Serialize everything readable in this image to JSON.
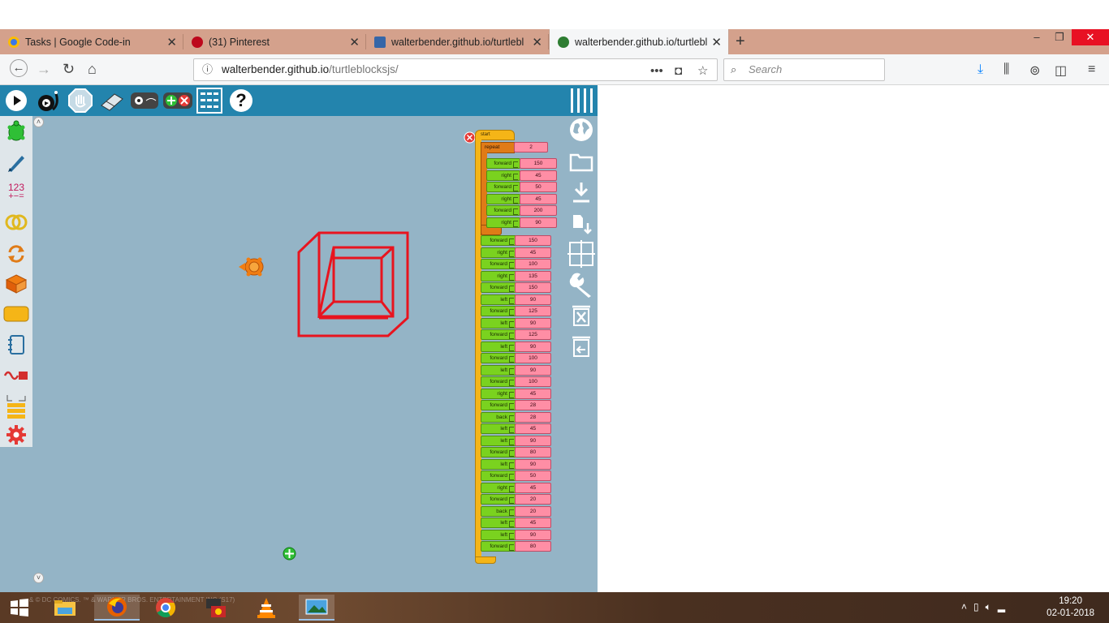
{
  "tabs": [
    {
      "title": "Tasks | Google Code-in",
      "favicon_color": "#3b78e7"
    },
    {
      "title": "(31) Pinterest",
      "favicon_color": "#bd081c"
    },
    {
      "title": "walterbender.github.io/turtlebl",
      "favicon_color": "#3566a8"
    },
    {
      "title": "walterbender.github.io/turtlebl",
      "favicon_color": "#2e7d32"
    }
  ],
  "url": {
    "host": "walterbender.github.io",
    "path": "/turtleblocksjs/"
  },
  "search": {
    "placeholder": "Search"
  },
  "window_controls": {
    "min": "–",
    "max": "❐",
    "close": "✕"
  },
  "new_tab": "+",
  "toolbar_help": "?",
  "palette": {
    "numbers_icon": "123"
  },
  "start_label": "start",
  "repeat": {
    "label": "repeat",
    "count": "2"
  },
  "repeat_body": [
    {
      "cmd": "forward",
      "arg": "150"
    },
    {
      "cmd": "right",
      "arg": "45"
    },
    {
      "cmd": "forward",
      "arg": "50"
    },
    {
      "cmd": "right",
      "arg": "45"
    },
    {
      "cmd": "forward",
      "arg": "200"
    },
    {
      "cmd": "right",
      "arg": "90"
    }
  ],
  "program": [
    {
      "cmd": "forward",
      "arg": "150"
    },
    {
      "cmd": "right",
      "arg": "45"
    },
    {
      "cmd": "forward",
      "arg": "100"
    },
    {
      "cmd": "right",
      "arg": "135"
    },
    {
      "cmd": "forward",
      "arg": "150"
    },
    {
      "cmd": "left",
      "arg": "90"
    },
    {
      "cmd": "forward",
      "arg": "125"
    },
    {
      "cmd": "left",
      "arg": "90"
    },
    {
      "cmd": "forward",
      "arg": "125"
    },
    {
      "cmd": "left",
      "arg": "90"
    },
    {
      "cmd": "forward",
      "arg": "100"
    },
    {
      "cmd": "left",
      "arg": "90"
    },
    {
      "cmd": "forward",
      "arg": "100"
    },
    {
      "cmd": "right",
      "arg": "45"
    },
    {
      "cmd": "forward",
      "arg": "28"
    },
    {
      "cmd": "back",
      "arg": "28"
    },
    {
      "cmd": "left",
      "arg": "45"
    },
    {
      "cmd": "left",
      "arg": "90"
    },
    {
      "cmd": "forward",
      "arg": "80"
    },
    {
      "cmd": "left",
      "arg": "90"
    },
    {
      "cmd": "forward",
      "arg": "50"
    },
    {
      "cmd": "right",
      "arg": "45"
    },
    {
      "cmd": "forward",
      "arg": "20"
    },
    {
      "cmd": "back",
      "arg": "20"
    },
    {
      "cmd": "left",
      "arg": "45"
    },
    {
      "cmd": "left",
      "arg": "90"
    },
    {
      "cmd": "forward",
      "arg": "80"
    }
  ],
  "taskbar": {
    "watermark": "& © DC COMICS. ™ & WARNER BROS. ENTERTAINMENT INC (S17)",
    "time": "19:20",
    "date": "02-01-2018"
  },
  "colors": {
    "canvas": "#94b4c6",
    "toolbar": "#2384ad",
    "drawing": "#e8141f",
    "blocks": "#7ad21f",
    "numbers": "#ff8ea5",
    "flow": "#f5b517"
  }
}
